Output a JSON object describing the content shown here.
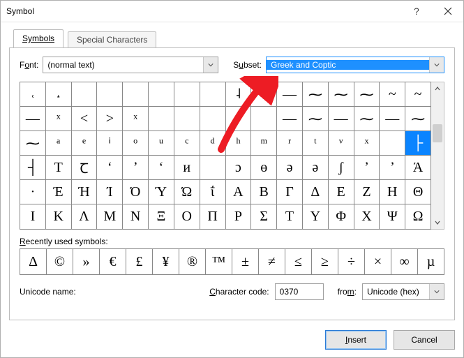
{
  "window": {
    "title": "Symbol"
  },
  "tabs": {
    "symbols": "Symbols",
    "special": "Special Characters"
  },
  "font": {
    "label_pre": "F",
    "label_u": "o",
    "label_post": "nt:",
    "value": "(normal text)"
  },
  "subset": {
    "label_pre": "S",
    "label_u": "u",
    "label_post": "bset:",
    "value": "Greek and Coptic"
  },
  "grid": {
    "rows": [
      [
        "˓",
        "˔",
        "",
        "",
        "",
        "",
        "",
        "",
        "˨",
        "",
        "—",
        "⁓",
        "⁓",
        "⁓",
        "~",
        "~"
      ],
      [
        "—",
        "ˣ",
        "<",
        ">",
        "ˣ",
        "",
        "",
        "",
        "ᶿ",
        "",
        "—",
        "⁓",
        "—",
        "⁓",
        "—",
        "⁓"
      ],
      [
        "⁓",
        "ᵃ",
        "ᵉ",
        "ⁱ",
        "ᵒ",
        "ᵘ",
        "ᶜ",
        "ᵈ",
        "ʰ",
        "ᵐ",
        "ʳ",
        "ᵗ",
        "ᵛ",
        "ˣ",
        "",
        "├"
      ],
      [
        "┤",
        "Т",
        "Ꞇ",
        "ʻ",
        "ʼ",
        "ʻ",
        "и",
        "",
        "ɔ",
        "ɵ",
        "ə",
        "ə",
        "ʃ",
        "ʼ",
        "ʼ",
        "Ά"
      ],
      [
        "·",
        "Έ",
        "Ή",
        "Ί",
        "Ό",
        "Ύ",
        "Ώ",
        "ΐ",
        "Α",
        "Β",
        "Γ",
        "Δ",
        "Ε",
        "Ζ",
        "Η",
        "Θ"
      ],
      [
        "Ι",
        "Κ",
        "Λ",
        "Μ",
        "Ν",
        "Ξ",
        "Ο",
        "Π",
        "Ρ",
        "Σ",
        "Τ",
        "Υ",
        "Φ",
        "Χ",
        "Ψ",
        "Ω"
      ]
    ],
    "selected": {
      "row": 2,
      "col": 15
    }
  },
  "recent": {
    "label_pre": "",
    "label_u": "R",
    "label_post": "ecently used symbols:",
    "items": [
      "Δ",
      "©",
      "»",
      "€",
      "£",
      "¥",
      "®",
      "™",
      "±",
      "≠",
      "≤",
      "≥",
      "÷",
      "×",
      "∞",
      "µ"
    ]
  },
  "unicode_name": {
    "label": "Unicode name:",
    "value": ""
  },
  "charcode": {
    "label_u": "C",
    "label_post": "haracter code:",
    "value": "0370"
  },
  "from": {
    "label_pre": "fro",
    "label_u": "m",
    "label_post": ":",
    "value": "Unicode (hex)"
  },
  "buttons": {
    "insert_u": "I",
    "insert_post": "nsert",
    "cancel": "Cancel"
  }
}
